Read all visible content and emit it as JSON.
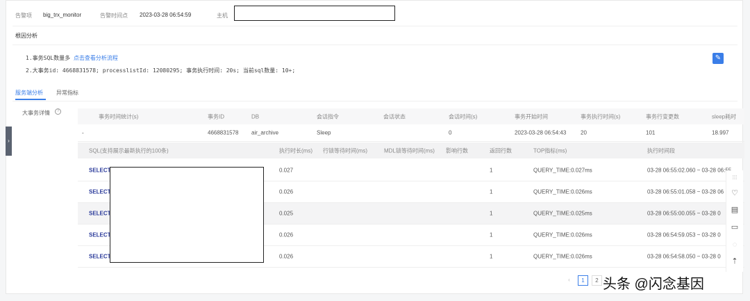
{
  "alert": {
    "item_label": "告警项",
    "item_value": "big_trx_monitor",
    "time_label": "告警时间点",
    "time_value": "2023-03-28 06:54:59",
    "host_label": "主机"
  },
  "root_cause": {
    "title": "根因分析",
    "line1_prefix": "1.事务SQL数量多 ",
    "line1_link": "点击查看分析流程",
    "line2": "2.大事务id: 4668831578; processlistId: 12080295; 事务执行时间: 20s; 当前sql数量: 10+;"
  },
  "tabs": [
    {
      "label": "服务端分析",
      "active": true
    },
    {
      "label": "异常指标",
      "active": false
    }
  ],
  "section_label": "大事务详情",
  "trx_table": {
    "headers": [
      "事务时间统计(s)",
      "事务ID",
      "DB",
      "会话指令",
      "会话状态",
      "会话时间(s)",
      "事务开始时间",
      "事务执行时间(s)",
      "事务行变更数",
      "sleep耗时"
    ],
    "row": [
      "-",
      "4668831578",
      "air_archive",
      "Sleep",
      "",
      "0",
      "2023-03-28 06:54:43",
      "20",
      "101",
      "18.997"
    ]
  },
  "sql_table": {
    "headers": [
      "SQL(支持展示最新执行的100条)",
      "执行时长(ms)",
      "行锁等待时间(ms)",
      "MDL锁等待时间(ms)",
      "影响行数",
      "返回行数",
      "TOP指标(ms)",
      "执行时间段"
    ],
    "rows": [
      [
        "SELECT",
        "0.027",
        "",
        "",
        "",
        "1",
        "QUERY_TIME:0.027ms",
        "03-28 06:55:02.060 ~ 03-28 06:55"
      ],
      [
        "SELECT",
        "0.026",
        "",
        "",
        "",
        "1",
        "QUERY_TIME:0.026ms",
        "03-28 06:55:01.058 ~ 03-28 06"
      ],
      [
        "SELECT",
        "0.025",
        "",
        "",
        "",
        "1",
        "QUERY_TIME:0.025ms",
        "03-28 06:55:00.055 ~ 03-28 0"
      ],
      [
        "SELECT",
        "0.026",
        "",
        "",
        "",
        "1",
        "QUERY_TIME:0.026ms",
        "03-28 06:54:59.053 ~ 03-28 0"
      ],
      [
        "SELECT",
        "0.026",
        "",
        "",
        "",
        "1",
        "QUERY_TIME:0.026ms",
        "03-28 06:54:58.050 ~ 03-28 0"
      ]
    ]
  },
  "pagination": {
    "prev": "‹",
    "pages": [
      "1",
      "2"
    ],
    "current": "1"
  },
  "watermark": "头条 @闪念基因",
  "colors": {
    "accent": "#3a7ee8"
  }
}
